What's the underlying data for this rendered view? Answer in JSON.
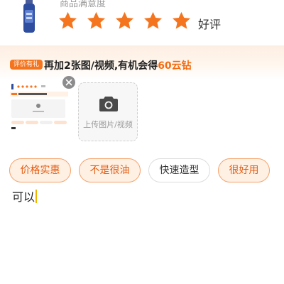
{
  "rating": {
    "label": "商品满意度",
    "stars": 5,
    "max_stars": 5,
    "text": "好评",
    "star_color": "#f5751f"
  },
  "reward": {
    "tag": "评价有礼",
    "text_prefix": "再加2张图/视频,有机会得",
    "highlight": "60云钻",
    "accent_color": "#f36b10"
  },
  "media": {
    "upload_label": "上传图片/视频",
    "remove_icon": "close-icon",
    "upload_icon": "camera-icon"
  },
  "tags": [
    {
      "label": "价格实惠",
      "selected": true
    },
    {
      "label": "不是很油",
      "selected": true
    },
    {
      "label": "快速造型",
      "selected": false
    },
    {
      "label": "很好用",
      "selected": true
    }
  ],
  "review": {
    "text": "可以"
  }
}
